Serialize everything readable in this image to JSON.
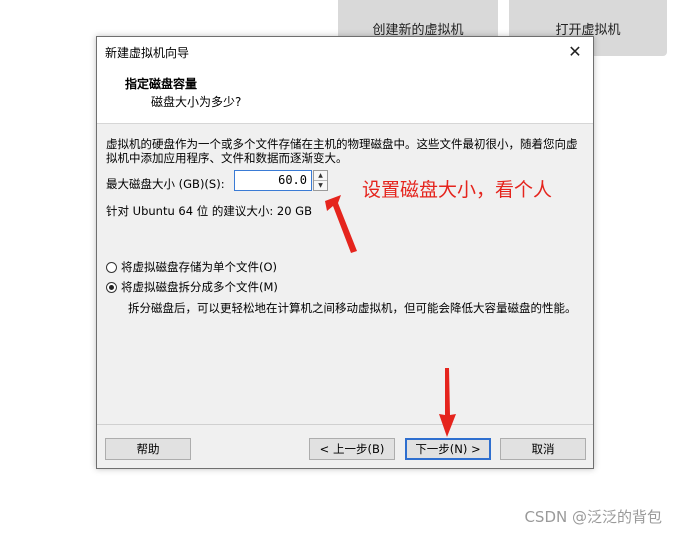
{
  "background": {
    "create_vm_button": "创建新的虚拟机",
    "open_vm_button": "打开虚拟机"
  },
  "dialog": {
    "title": "新建虚拟机向导",
    "close_glyph": "✕",
    "header_title": "指定磁盘容量",
    "header_subtitle": "磁盘大小为多少?",
    "description": "虚拟机的硬盘作为一个或多个文件存储在主机的物理磁盘中。这些文件最初很小，随着您向虚拟机中添加应用程序、文件和数据而逐渐变大。",
    "max_size_label": "最大磁盘大小 (GB)(S):",
    "max_size_value": "60.0",
    "recommended": "针对 Ubuntu 64 位 的建议大小: 20 GB",
    "radio_single_label": "将虚拟磁盘存储为单个文件(O)",
    "radio_multi_label": "将虚拟磁盘拆分成多个文件(M)",
    "radio_selected": "multi",
    "split_description": "拆分磁盘后，可以更轻松地在计算机之间移动虚拟机，但可能会降低大容量磁盘的性能。",
    "help_button": "帮助",
    "back_button": "< 上一步(B)",
    "next_button": "下一步(N) >",
    "cancel_button": "取消"
  },
  "annotation": {
    "text": "设置磁盘大小，看个人",
    "color": "#e5241d"
  },
  "watermark": "CSDN @泛泛的背包"
}
